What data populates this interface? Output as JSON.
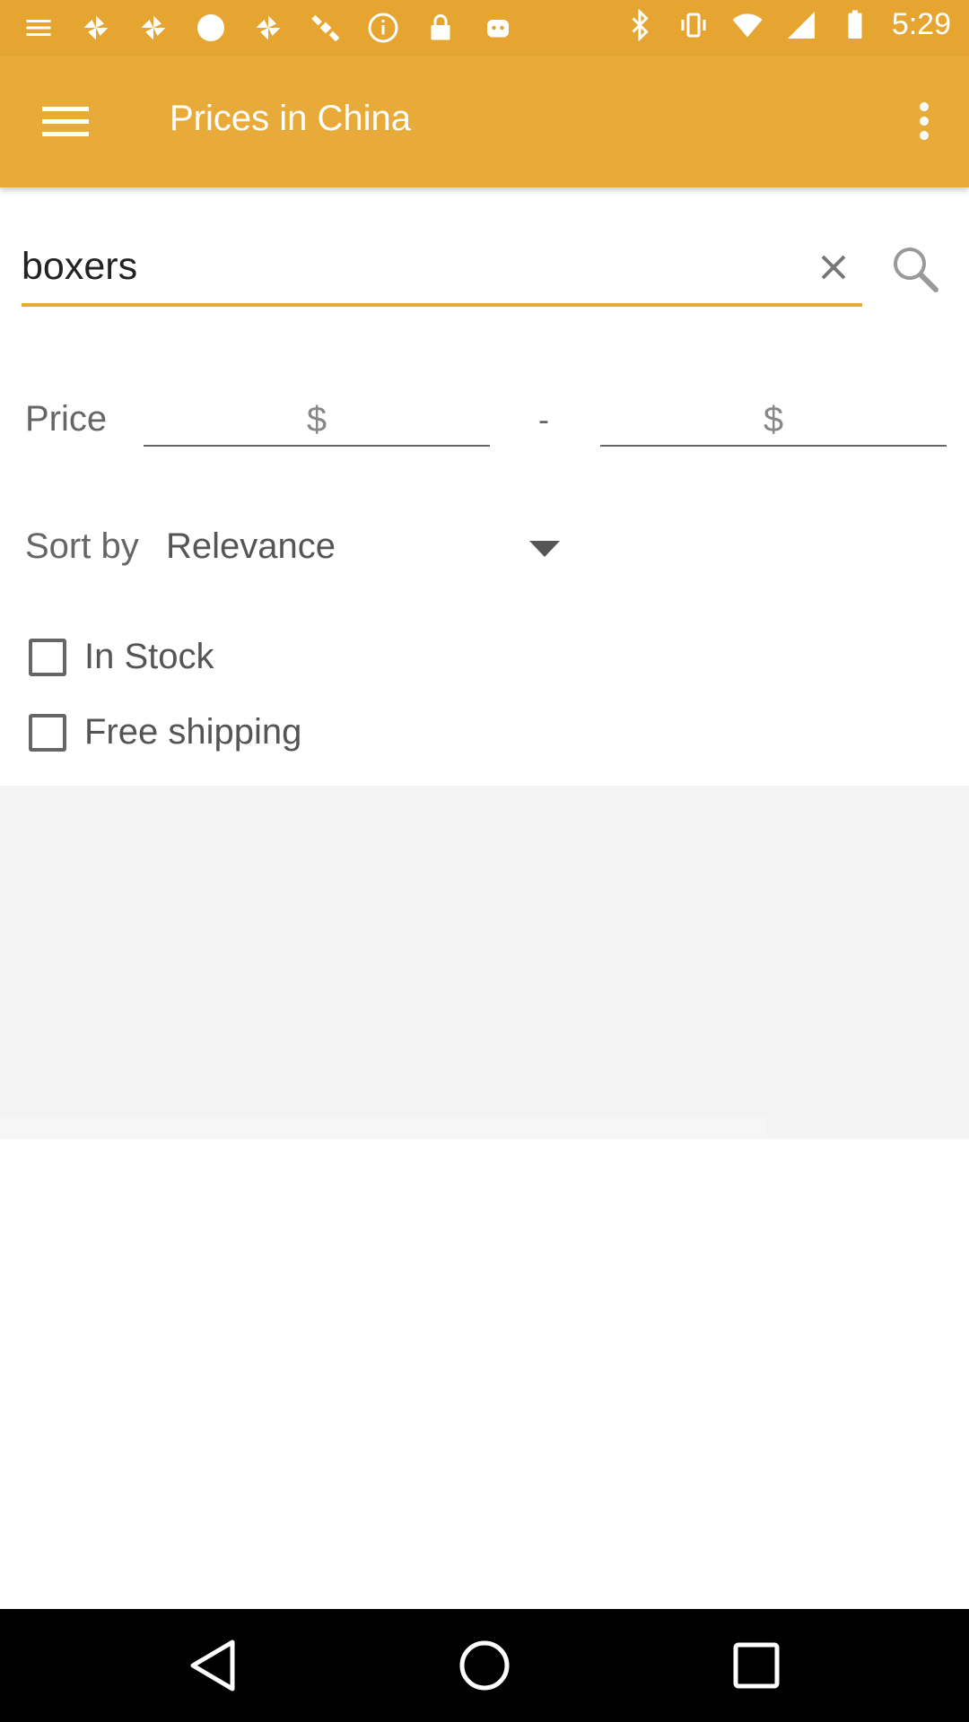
{
  "status_bar": {
    "time": "5:29",
    "left_icons": [
      "menu-icon",
      "pinwheel-icon",
      "pinwheel-icon",
      "record-icon",
      "pinwheel-icon",
      "satellite-icon",
      "info-icon",
      "lock-icon",
      "android-icon"
    ],
    "right_icons": [
      "bluetooth-icon",
      "vibrate-icon",
      "wifi-icon",
      "signal-icon",
      "battery-icon"
    ]
  },
  "app_bar": {
    "title": "Prices in China",
    "menu_icon": "hamburger-icon",
    "overflow_icon": "more-vert-icon",
    "color": "#e8ab3a"
  },
  "search": {
    "value": "boxers",
    "clear_icon": "close-icon",
    "search_icon": "search-icon"
  },
  "price": {
    "label": "Price",
    "min_placeholder": "$",
    "separator": "-",
    "max_placeholder": "$"
  },
  "sort": {
    "label": "Sort by",
    "selected": "Relevance"
  },
  "filters": [
    {
      "label": "In Stock",
      "checked": false
    },
    {
      "label": "Free shipping",
      "checked": false
    }
  ],
  "nav_bar": {
    "buttons": [
      "back-icon",
      "home-icon",
      "recents-icon"
    ]
  }
}
